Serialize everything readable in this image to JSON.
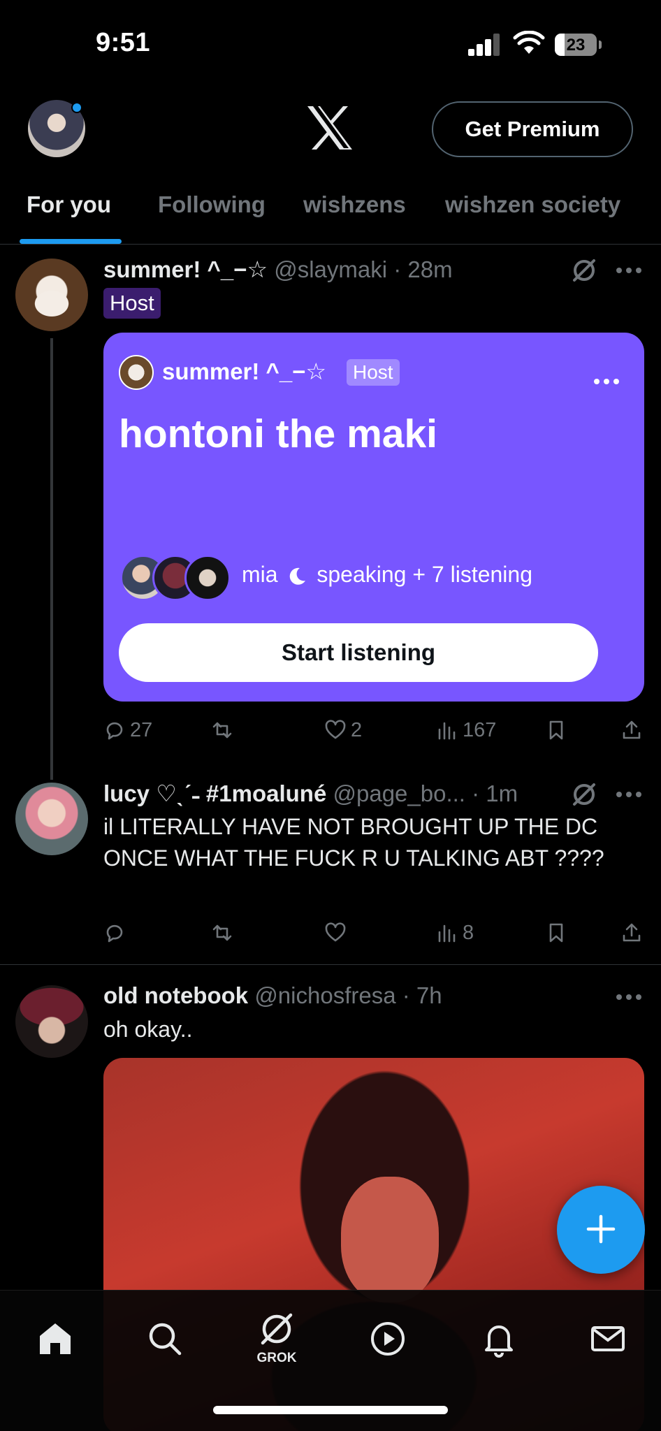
{
  "status_bar": {
    "time": "9:51",
    "battery": "23",
    "battery_level": 0.23
  },
  "header": {
    "premium_label": "Get Premium",
    "logo_icon": "x-logo-icon"
  },
  "tabs": [
    {
      "label": "For you",
      "active": true
    },
    {
      "label": "Following",
      "active": false
    },
    {
      "label": "wishzens",
      "active": false
    },
    {
      "label": "wishzen society",
      "active": false
    }
  ],
  "posts": [
    {
      "name": "summer! ^_−☆",
      "meta": "@slaymaki · 28m",
      "badge": "Host",
      "space": {
        "host_name": "summer! ^_−☆",
        "host_badge": "Host",
        "title": "hontoni the maki",
        "speaker": "mia",
        "speaking_suffix": "speaking + 7 listening",
        "button_label": "Start listening",
        "accent": "#7856ff"
      },
      "stats": {
        "replies": "27",
        "reposts": "",
        "likes": "2",
        "views": "167"
      }
    },
    {
      "name": "lucy ♡ˎˊ˗ #1moaluné",
      "meta": "@page_bo... · 1m",
      "text": "il LITERALLY HAVE NOT BROUGHT UP THE DC ONCE WHAT THE FUCK R U TALKING ABT ????",
      "stats": {
        "replies": "",
        "reposts": "",
        "likes": "",
        "views": "8"
      }
    },
    {
      "name": "old notebook",
      "meta": "@nichosfresa · 7h",
      "text": "oh okay.."
    }
  ],
  "bottom_nav": {
    "grok_label": "GROK"
  },
  "colors": {
    "accent_blue": "#1d9bf0",
    "muted": "#71767b",
    "space_purple": "#7856ff"
  }
}
